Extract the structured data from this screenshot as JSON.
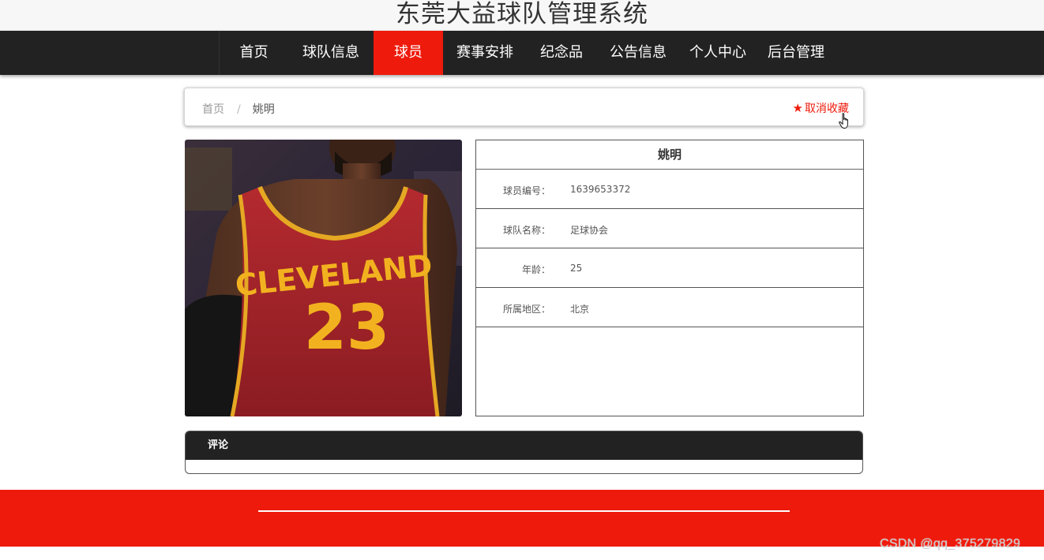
{
  "site": {
    "title": "东莞大益球队管理系统"
  },
  "nav": {
    "items": [
      {
        "label": "首页",
        "active": false
      },
      {
        "label": "球队信息",
        "active": false
      },
      {
        "label": "球员",
        "active": true
      },
      {
        "label": "赛事安排",
        "active": false
      },
      {
        "label": "纪念品",
        "active": false
      },
      {
        "label": "公告信息",
        "active": false
      },
      {
        "label": "个人中心",
        "active": false
      },
      {
        "label": "后台管理",
        "active": false
      }
    ]
  },
  "breadcrumb": {
    "home": "首页",
    "separator": "/",
    "current": "姚明",
    "favorite_label": "取消收藏",
    "favorite_icon": "star-icon"
  },
  "player": {
    "name": "姚明",
    "photo_icon": "basketball-player-photo",
    "fields": [
      {
        "label": "球员编号：",
        "value": "1639653372"
      },
      {
        "label": "球队名称：",
        "value": "足球协会"
      },
      {
        "label": "年龄：",
        "value": "25"
      },
      {
        "label": "所属地区：",
        "value": "北京"
      }
    ]
  },
  "comments": {
    "title": "评论"
  },
  "watermark": "CSDN @qq_375279829",
  "colors": {
    "accent": "#ee1a0b",
    "nav_bg": "#222222"
  }
}
